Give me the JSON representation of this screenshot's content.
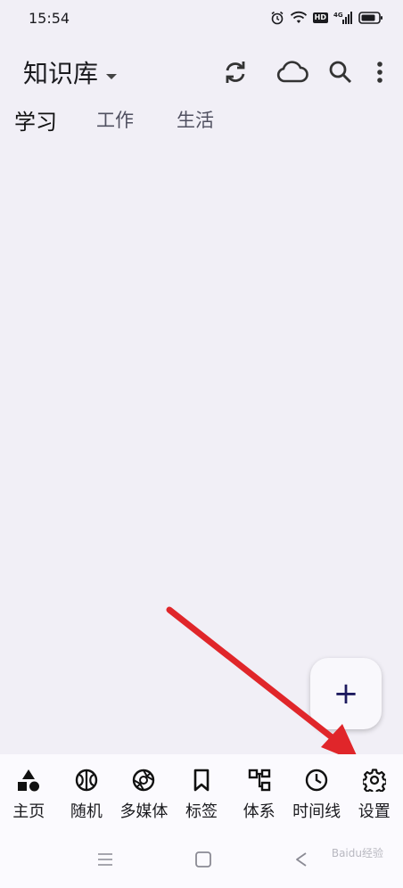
{
  "status_bar": {
    "time": "15:54",
    "hd_badge": "HD",
    "network": "4G"
  },
  "app_bar": {
    "title": "知识库",
    "icons": [
      "caret-down-icon",
      "sync-icon",
      "cloud-icon",
      "search-icon",
      "more-vert-icon"
    ]
  },
  "tabs": [
    {
      "label": "学习",
      "active": true
    },
    {
      "label": "工作",
      "active": false
    },
    {
      "label": "生活",
      "active": false
    }
  ],
  "fab": {
    "label": "+"
  },
  "bottom_nav": [
    {
      "label": "主页",
      "icon": "home-shapes-icon"
    },
    {
      "label": "随机",
      "icon": "random-icon"
    },
    {
      "label": "多媒体",
      "icon": "media-aperture-icon"
    },
    {
      "label": "标签",
      "icon": "bookmark-icon"
    },
    {
      "label": "体系",
      "icon": "hierarchy-icon"
    },
    {
      "label": "时间线",
      "icon": "clock-icon"
    },
    {
      "label": "设置",
      "icon": "gear-icon"
    }
  ],
  "annotation": {
    "arrow_color": "#e0262a"
  },
  "watermark": "Baidu经验"
}
